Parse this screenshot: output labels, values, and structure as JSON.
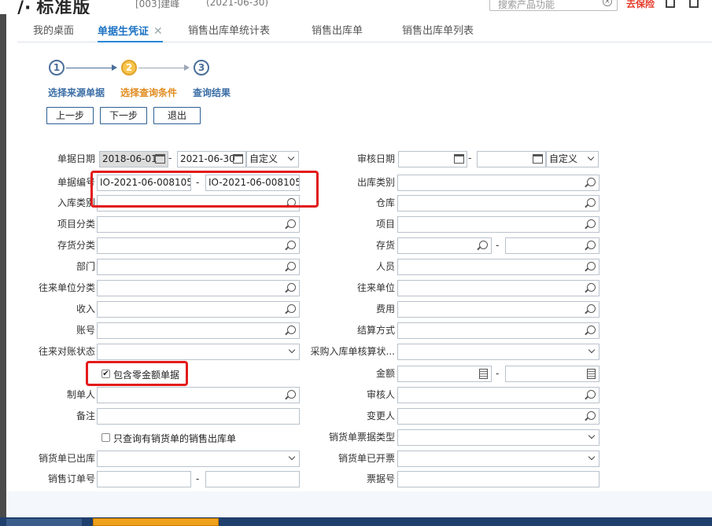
{
  "header": {
    "brand": "标准版",
    "account": "[003]建峰",
    "date": "(2021-06-30)",
    "search_placeholder": "搜索产品功能",
    "top_link": "去保险"
  },
  "tabs": [
    {
      "label": "我的桌面"
    },
    {
      "label": "单据生凭证",
      "close": "✕"
    },
    {
      "label": "销售出库单统计表"
    },
    {
      "label": "销售出库单"
    },
    {
      "label": "销售出库单列表"
    }
  ],
  "wizard": {
    "steps": [
      {
        "num": "1",
        "label": "选择来源单据"
      },
      {
        "num": "2",
        "label": "选择查询条件"
      },
      {
        "num": "3",
        "label": "查询结果"
      }
    ],
    "buttons": {
      "prev": "上一步",
      "next": "下一步",
      "exit": "退出"
    }
  },
  "form": {
    "left": {
      "doc_date": {
        "label": "单据日期",
        "from": "2018-06-01",
        "to": "2021-06-30",
        "mode": "自定义"
      },
      "doc_no": {
        "label": "单据编号",
        "from": "IO-2021-06-008105",
        "to": "IO-2021-06-008105"
      },
      "in_type": {
        "label": "入库类别"
      },
      "proj_class": {
        "label": "项目分类"
      },
      "inv_class": {
        "label": "存货分类"
      },
      "dept": {
        "label": "部门"
      },
      "partner_class": {
        "label": "往来单位分类"
      },
      "income": {
        "label": "收入"
      },
      "account": {
        "label": "账号"
      },
      "recon_status": {
        "label": "往来对账状态"
      },
      "zero_amount": {
        "label": "包含零金额单据",
        "checked": true
      },
      "maker": {
        "label": "制单人"
      },
      "remark": {
        "label": "备注"
      },
      "only_invoiced": {
        "label": "只查询有销货单的销售出库单",
        "checked": false
      },
      "sale_out": {
        "label": "销货单已出库"
      },
      "so_no": {
        "label": "销售订单号"
      }
    },
    "right": {
      "audit_date": {
        "label": "审核日期",
        "mode": "自定义"
      },
      "out_type": {
        "label": "出库类别"
      },
      "warehouse": {
        "label": "仓库"
      },
      "project": {
        "label": "项目"
      },
      "inventory": {
        "label": "存货"
      },
      "person": {
        "label": "人员"
      },
      "partner": {
        "label": "往来单位"
      },
      "expense": {
        "label": "费用"
      },
      "settle": {
        "label": "结算方式"
      },
      "purchase_status": {
        "label": "采购入库单核算状..."
      },
      "amount": {
        "label": "金额"
      },
      "auditor": {
        "label": "审核人"
      },
      "changer": {
        "label": "变更人"
      },
      "invoice_type": {
        "label": "销货单票据类型"
      },
      "invoiced": {
        "label": "销货单已开票"
      },
      "bill_no": {
        "label": "票据号"
      }
    },
    "dash": "-"
  },
  "colors": {
    "accent": "#2b86d6",
    "current_step": "#f7c44d",
    "highlight": "#e21b1b"
  }
}
